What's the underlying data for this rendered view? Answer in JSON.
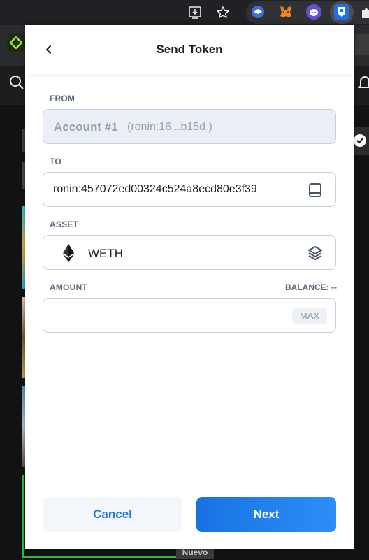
{
  "browser": {
    "toolbar_icons": [
      "install-icon",
      "star-icon",
      "puzzle-icon"
    ],
    "extensions": [
      "extension-blue-icon",
      "metamask-fox-icon",
      "extension-purple-icon",
      "ronin-wallet-icon"
    ],
    "background_tag": "Nuevo"
  },
  "popup": {
    "title": "Send Token",
    "from": {
      "label": "FROM",
      "account": "Account #1",
      "address": "(ronin:16...b15d )"
    },
    "to": {
      "label": "TO",
      "value": "ronin:457072ed00324c524a8ecd80e3f39"
    },
    "asset": {
      "label": "ASSET",
      "value": "WETH",
      "icon": "ethereum-icon"
    },
    "amount": {
      "label": "AMOUNT",
      "balance": "BALANCE: --",
      "value": "",
      "max_label": "MAX"
    },
    "buttons": {
      "cancel": "Cancel",
      "next": "Next"
    }
  },
  "colors": {
    "primary": "#1c79e7",
    "text": "#1b1f28",
    "muted": "#97a3b4"
  }
}
